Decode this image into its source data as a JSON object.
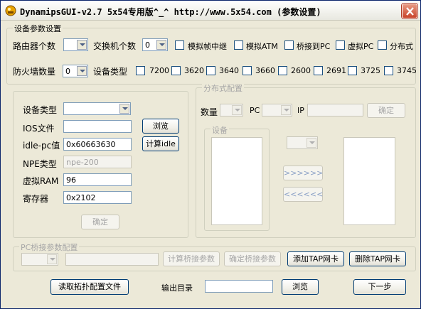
{
  "window": {
    "title": "DynamipsGUI-v2.7   5x54专用版^_^ http://www.5x54.com  (参数设置)"
  },
  "device_params": {
    "group_title": "设备参数设置",
    "router_count_label": "路由器个数",
    "router_count_value": "",
    "switch_count_label": "交换机个数",
    "switch_count_value": "0",
    "checkboxes": [
      "模拟帧中继",
      "模拟ATM",
      "桥接到PC",
      "虚拟PC",
      "分布式"
    ],
    "firewall_count_label": "防火墙数量",
    "firewall_count_value": "0",
    "device_type_label": "设备类型",
    "device_types": [
      "7200",
      "3620",
      "3640",
      "3660",
      "2600",
      "2691",
      "3725",
      "3745"
    ]
  },
  "left_panel": {
    "device_type_label": "设备类型",
    "device_type_value": "",
    "ios_label": "IOS文件",
    "ios_value": "",
    "browse_label": "浏览",
    "idlepc_label": "idle-pc值",
    "idlepc_value": "0x60663630",
    "calc_idle_label": "计算idle",
    "npe_label": "NPE类型",
    "npe_value": "npe-200",
    "ram_label": "虚拟RAM",
    "ram_value": "96",
    "register_label": "寄存器",
    "register_value": "0x2102",
    "confirm_label": "确定"
  },
  "distributed": {
    "group_title": "分布式配置",
    "count_label": "数量",
    "pc_label": "PC",
    "ip_label": "IP",
    "confirm_label": "确定",
    "devices_title": "设备",
    "move_right_label": ">>>>>>",
    "move_left_label": "<<<<<<"
  },
  "bridge": {
    "group_title": "PC桥接参数配置",
    "calc_label": "计算桥接参数",
    "confirm_label": "确定桥接参数",
    "add_tap_label": "添加TAP网卡",
    "remove_tap_label": "删除TAP网卡"
  },
  "bottom": {
    "read_topology_label": "读取拓扑配置文件",
    "output_dir_label": "输出目录",
    "output_dir_value": "",
    "browse_label": "浏览",
    "next_label": "下一步"
  },
  "colors": {
    "window_bg": "#ece9d8",
    "close_button": "#c9442a",
    "button_border": "#003c74",
    "input_border": "#7f9db9"
  }
}
